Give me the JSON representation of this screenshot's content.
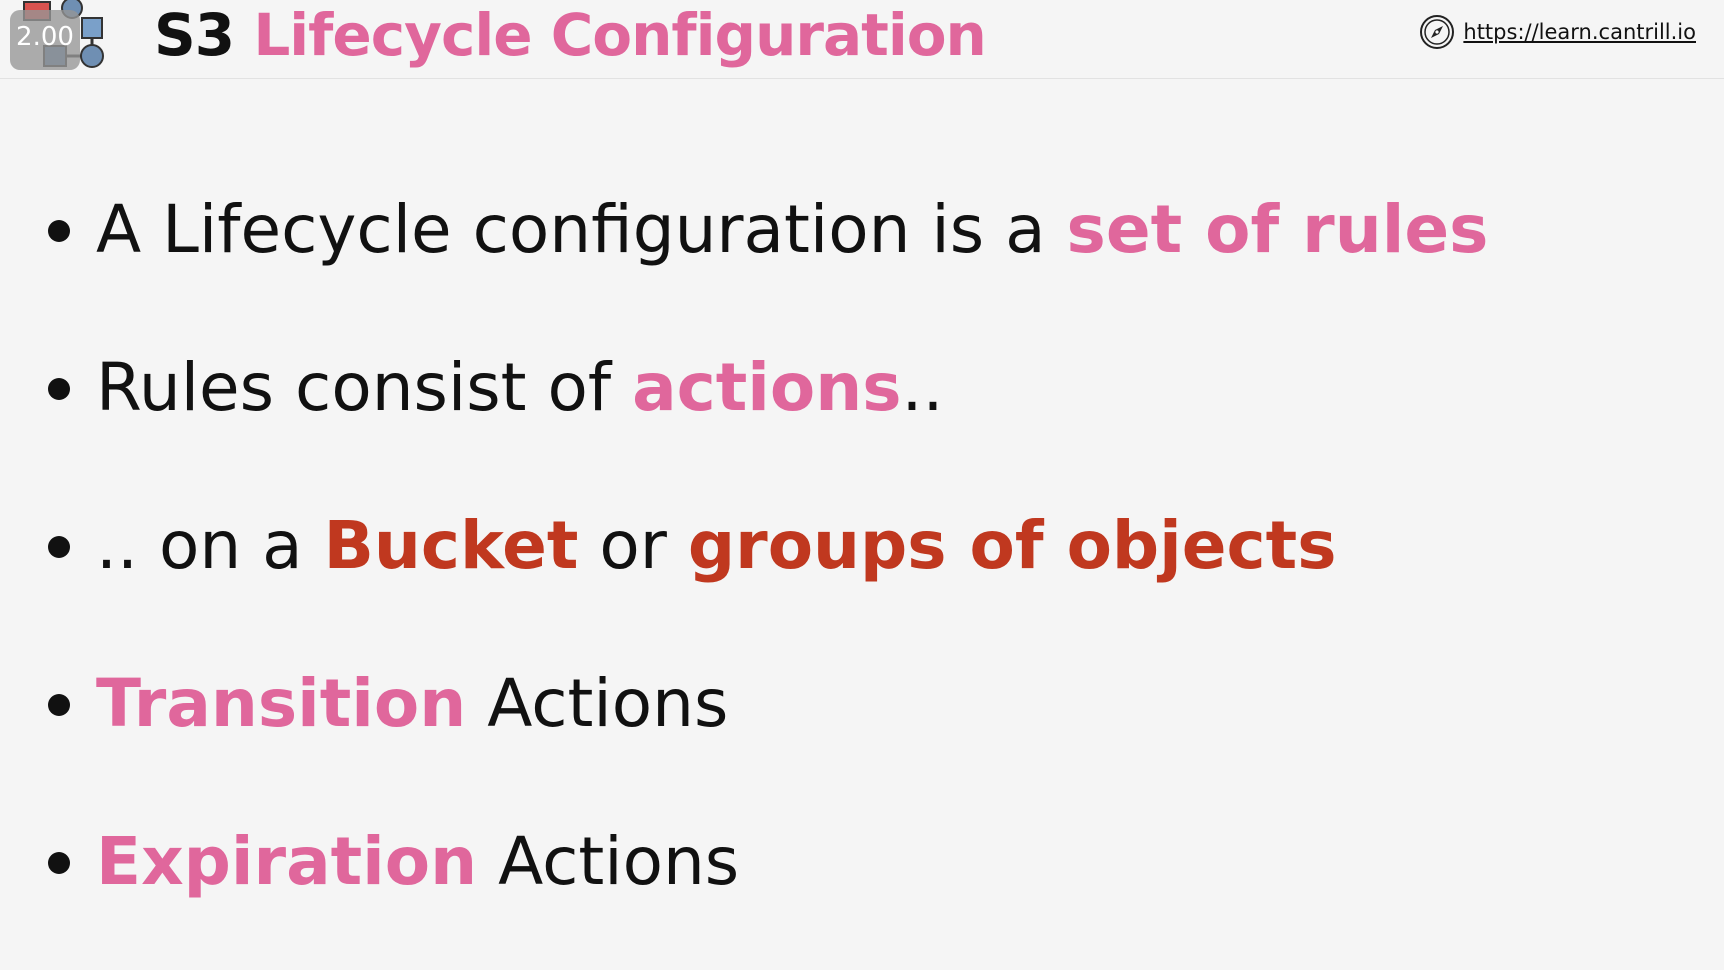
{
  "header": {
    "speed_badge": "2.00",
    "title_prefix": "S3",
    "title_rest": "Lifecycle Configuration",
    "site_link": "https://learn.cantrill.io"
  },
  "bullets": [
    {
      "a": "A Lifecycle configuration is a ",
      "b": "set of rules"
    },
    {
      "a": "Rules consist of ",
      "b": "actions",
      "c": ".."
    },
    {
      "a": ".. on a ",
      "b": "Bucket",
      "c": " or ",
      "d": "groups of objects"
    },
    {
      "a": "Transition",
      "b": " Actions"
    },
    {
      "a": "Expiration",
      "b": " Actions"
    }
  ],
  "colors": {
    "accent_pink": "#e0679c",
    "accent_red": "#c0381f",
    "text": "#111111",
    "background": "#f5f5f5"
  },
  "icons": {
    "logo": "diagram-logo-icon",
    "site": "compass-icon"
  }
}
